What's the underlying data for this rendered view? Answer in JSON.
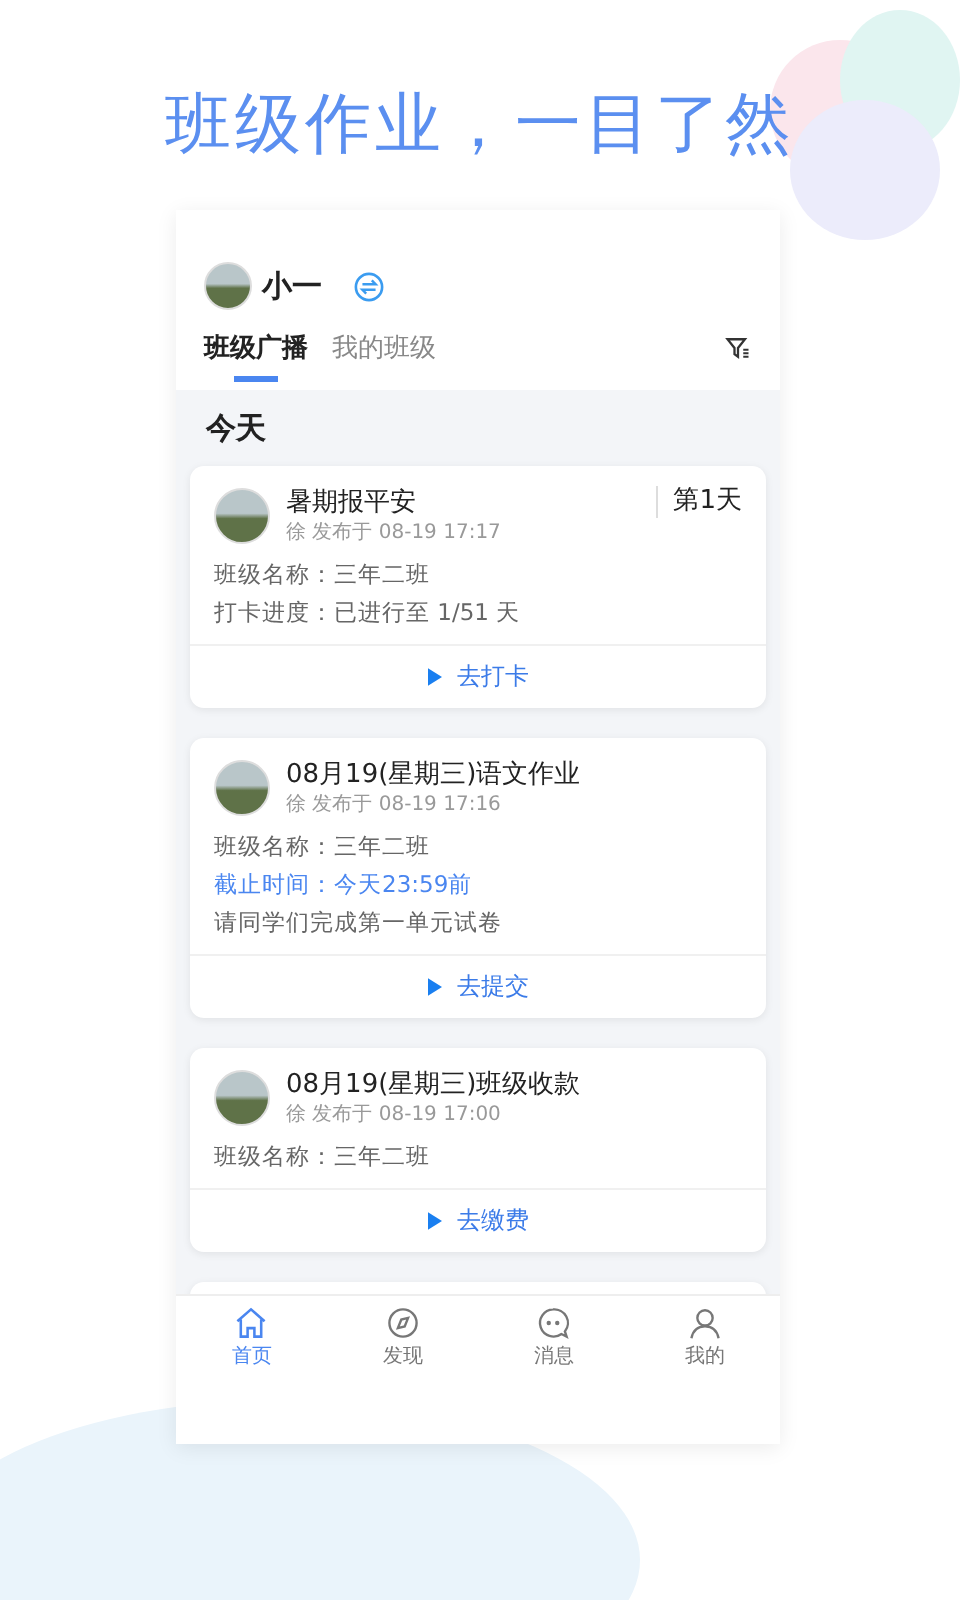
{
  "headline": "班级作业，一目了然",
  "user": {
    "name": "小一"
  },
  "tabs": [
    {
      "label": "班级广播",
      "selected": true
    },
    {
      "label": "我的班级",
      "selected": false
    }
  ],
  "section_title": "今天",
  "cards": [
    {
      "title": "暑期报平安",
      "meta": "徐 发布于 08-19 17:17",
      "badge": "第1天",
      "lines": [
        {
          "kind": "plain",
          "text": "班级名称：三年二班"
        },
        {
          "kind": "plain",
          "text": "打卡进度：已进行至 1/51 天"
        }
      ],
      "action": "去打卡"
    },
    {
      "title": "08月19(星期三)语文作业",
      "meta": "徐 发布于 08-19 17:16",
      "lines": [
        {
          "kind": "plain",
          "text": "班级名称：三年二班"
        },
        {
          "kind": "deadline",
          "text": "截止时间：今天23:59前"
        },
        {
          "kind": "plain",
          "text": "请同学们完成第一单元试卷"
        }
      ],
      "action": "去提交"
    },
    {
      "title": "08月19(星期三)班级收款",
      "meta": "徐 发布于 08-19 17:00",
      "lines": [
        {
          "kind": "plain",
          "text": "班级名称：三年二班"
        }
      ],
      "action": "去缴费"
    }
  ],
  "nav": [
    {
      "kind": "home",
      "label": "首页",
      "selected": true
    },
    {
      "kind": "discover",
      "label": "发现",
      "selected": false
    },
    {
      "kind": "message",
      "label": "消息",
      "selected": false
    },
    {
      "kind": "profile",
      "label": "我的",
      "selected": false
    }
  ]
}
